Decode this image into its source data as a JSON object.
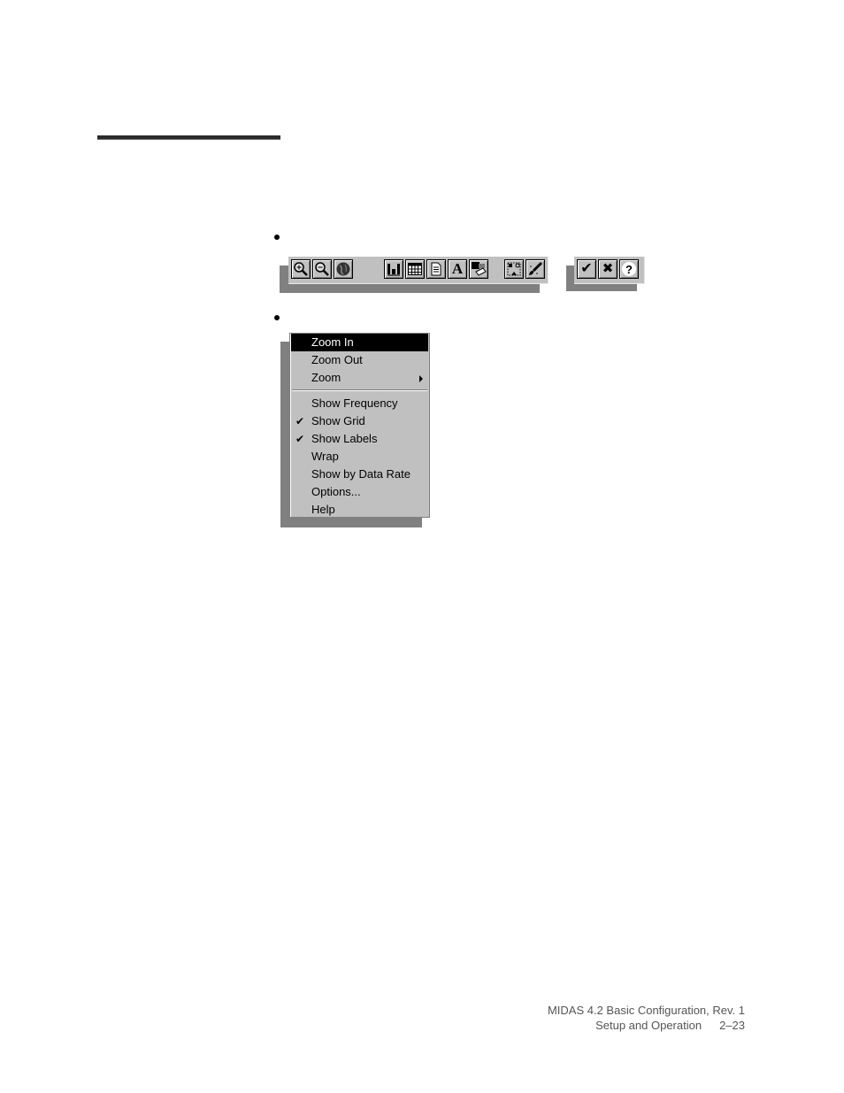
{
  "toolbar_main": {
    "buttons": [
      {
        "name": "zoom-in",
        "icon": "zoom-in-icon"
      },
      {
        "name": "zoom-out",
        "icon": "zoom-out-icon"
      },
      {
        "name": "globe",
        "icon": "globe-icon"
      },
      {
        "name": "chart-bar",
        "icon": "bar-chart-icon"
      },
      {
        "name": "table",
        "icon": "table-icon"
      },
      {
        "name": "document",
        "icon": "document-icon"
      },
      {
        "name": "text",
        "icon": "text-a-icon",
        "glyph": "A"
      },
      {
        "name": "paint",
        "icon": "paint-icon"
      },
      {
        "name": "select-area",
        "icon": "select-area-icon"
      },
      {
        "name": "brush-clear",
        "icon": "brush-icon"
      }
    ]
  },
  "toolbar_dialog": {
    "buttons": [
      {
        "name": "ok",
        "icon": "check-icon",
        "glyph": "✔"
      },
      {
        "name": "cancel",
        "icon": "x-icon",
        "glyph": "✖"
      },
      {
        "name": "help",
        "icon": "help-icon",
        "glyph": "?"
      }
    ]
  },
  "menu": {
    "items": [
      {
        "label": "Zoom In",
        "selected": true
      },
      {
        "label": "Zoom Out"
      },
      {
        "label": "Zoom",
        "submenu": true
      },
      {
        "label": "Show Frequency"
      },
      {
        "label": "Show Grid",
        "checked": true,
        "check": "✔"
      },
      {
        "label": "Show Labels",
        "checked": true,
        "check": "✔"
      },
      {
        "label": "Wrap"
      },
      {
        "label": "Show by Data Rate"
      },
      {
        "label": "Options..."
      },
      {
        "label": "Help"
      }
    ]
  },
  "footer": {
    "line1": "MIDAS 4.2 Basic Configuration, Rev. 1",
    "section": "Setup and Operation",
    "page": "2–23"
  }
}
